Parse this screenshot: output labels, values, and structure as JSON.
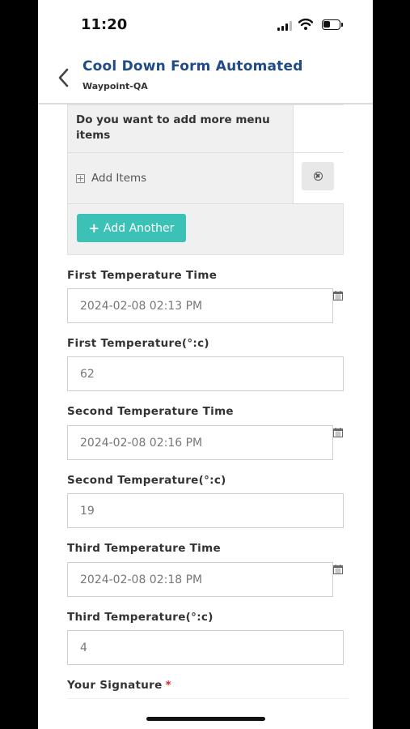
{
  "status_bar": {
    "time": "11:20"
  },
  "header": {
    "title": "Cool Down Form Automated",
    "subtitle": "Waypoint-QA"
  },
  "menu_table": {
    "question": "Do you want to add more menu items",
    "add_items_label": "Add Items",
    "add_another_label": "Add Another"
  },
  "fields": {
    "first_time": {
      "label": "First Temperature Time",
      "value": "2024-02-08 02:13 PM"
    },
    "first_temp": {
      "label": "First Temperature(°:c)",
      "value": "62"
    },
    "second_time": {
      "label": "Second Temperature Time",
      "value": "2024-02-08 02:16 PM"
    },
    "second_temp": {
      "label": "Second Temperature(°:c)",
      "value": "19"
    },
    "third_time": {
      "label": "Third Temperature Time",
      "value": "2024-02-08 02:18 PM"
    },
    "third_temp": {
      "label": "Third Temperature(°:c)",
      "value": "4"
    },
    "signature": {
      "label": "Your Signature",
      "required_marker": "*"
    }
  },
  "colors": {
    "title": "#1f4b86",
    "accent_button": "#3cc1b6",
    "required": "#e02424"
  },
  "icons": [
    "back-chevron-icon",
    "signal-icon",
    "wifi-icon",
    "battery-icon",
    "plus-square-icon",
    "remove-circle-icon",
    "plus-icon",
    "calendar-icon"
  ]
}
